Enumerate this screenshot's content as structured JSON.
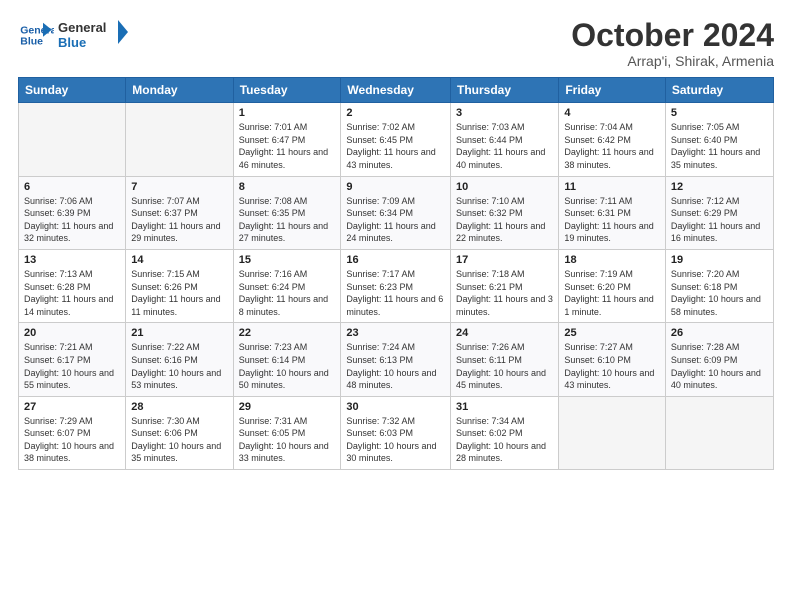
{
  "header": {
    "logo_line1": "General",
    "logo_line2": "Blue",
    "title": "October 2024",
    "subtitle": "Arrap'i, Shirak, Armenia"
  },
  "days_of_week": [
    "Sunday",
    "Monday",
    "Tuesday",
    "Wednesday",
    "Thursday",
    "Friday",
    "Saturday"
  ],
  "weeks": [
    [
      {
        "day": "",
        "empty": true
      },
      {
        "day": "",
        "empty": true
      },
      {
        "day": "1",
        "sunrise": "7:01 AM",
        "sunset": "6:47 PM",
        "daylight": "11 hours and 46 minutes."
      },
      {
        "day": "2",
        "sunrise": "7:02 AM",
        "sunset": "6:45 PM",
        "daylight": "11 hours and 43 minutes."
      },
      {
        "day": "3",
        "sunrise": "7:03 AM",
        "sunset": "6:44 PM",
        "daylight": "11 hours and 40 minutes."
      },
      {
        "day": "4",
        "sunrise": "7:04 AM",
        "sunset": "6:42 PM",
        "daylight": "11 hours and 38 minutes."
      },
      {
        "day": "5",
        "sunrise": "7:05 AM",
        "sunset": "6:40 PM",
        "daylight": "11 hours and 35 minutes."
      }
    ],
    [
      {
        "day": "6",
        "sunrise": "7:06 AM",
        "sunset": "6:39 PM",
        "daylight": "11 hours and 32 minutes."
      },
      {
        "day": "7",
        "sunrise": "7:07 AM",
        "sunset": "6:37 PM",
        "daylight": "11 hours and 29 minutes."
      },
      {
        "day": "8",
        "sunrise": "7:08 AM",
        "sunset": "6:35 PM",
        "daylight": "11 hours and 27 minutes."
      },
      {
        "day": "9",
        "sunrise": "7:09 AM",
        "sunset": "6:34 PM",
        "daylight": "11 hours and 24 minutes."
      },
      {
        "day": "10",
        "sunrise": "7:10 AM",
        "sunset": "6:32 PM",
        "daylight": "11 hours and 22 minutes."
      },
      {
        "day": "11",
        "sunrise": "7:11 AM",
        "sunset": "6:31 PM",
        "daylight": "11 hours and 19 minutes."
      },
      {
        "day": "12",
        "sunrise": "7:12 AM",
        "sunset": "6:29 PM",
        "daylight": "11 hours and 16 minutes."
      }
    ],
    [
      {
        "day": "13",
        "sunrise": "7:13 AM",
        "sunset": "6:28 PM",
        "daylight": "11 hours and 14 minutes."
      },
      {
        "day": "14",
        "sunrise": "7:15 AM",
        "sunset": "6:26 PM",
        "daylight": "11 hours and 11 minutes."
      },
      {
        "day": "15",
        "sunrise": "7:16 AM",
        "sunset": "6:24 PM",
        "daylight": "11 hours and 8 minutes."
      },
      {
        "day": "16",
        "sunrise": "7:17 AM",
        "sunset": "6:23 PM",
        "daylight": "11 hours and 6 minutes."
      },
      {
        "day": "17",
        "sunrise": "7:18 AM",
        "sunset": "6:21 PM",
        "daylight": "11 hours and 3 minutes."
      },
      {
        "day": "18",
        "sunrise": "7:19 AM",
        "sunset": "6:20 PM",
        "daylight": "11 hours and 1 minute."
      },
      {
        "day": "19",
        "sunrise": "7:20 AM",
        "sunset": "6:18 PM",
        "daylight": "10 hours and 58 minutes."
      }
    ],
    [
      {
        "day": "20",
        "sunrise": "7:21 AM",
        "sunset": "6:17 PM",
        "daylight": "10 hours and 55 minutes."
      },
      {
        "day": "21",
        "sunrise": "7:22 AM",
        "sunset": "6:16 PM",
        "daylight": "10 hours and 53 minutes."
      },
      {
        "day": "22",
        "sunrise": "7:23 AM",
        "sunset": "6:14 PM",
        "daylight": "10 hours and 50 minutes."
      },
      {
        "day": "23",
        "sunrise": "7:24 AM",
        "sunset": "6:13 PM",
        "daylight": "10 hours and 48 minutes."
      },
      {
        "day": "24",
        "sunrise": "7:26 AM",
        "sunset": "6:11 PM",
        "daylight": "10 hours and 45 minutes."
      },
      {
        "day": "25",
        "sunrise": "7:27 AM",
        "sunset": "6:10 PM",
        "daylight": "10 hours and 43 minutes."
      },
      {
        "day": "26",
        "sunrise": "7:28 AM",
        "sunset": "6:09 PM",
        "daylight": "10 hours and 40 minutes."
      }
    ],
    [
      {
        "day": "27",
        "sunrise": "7:29 AM",
        "sunset": "6:07 PM",
        "daylight": "10 hours and 38 minutes."
      },
      {
        "day": "28",
        "sunrise": "7:30 AM",
        "sunset": "6:06 PM",
        "daylight": "10 hours and 35 minutes."
      },
      {
        "day": "29",
        "sunrise": "7:31 AM",
        "sunset": "6:05 PM",
        "daylight": "10 hours and 33 minutes."
      },
      {
        "day": "30",
        "sunrise": "7:32 AM",
        "sunset": "6:03 PM",
        "daylight": "10 hours and 30 minutes."
      },
      {
        "day": "31",
        "sunrise": "7:34 AM",
        "sunset": "6:02 PM",
        "daylight": "10 hours and 28 minutes."
      },
      {
        "day": "",
        "empty": true
      },
      {
        "day": "",
        "empty": true
      }
    ]
  ]
}
